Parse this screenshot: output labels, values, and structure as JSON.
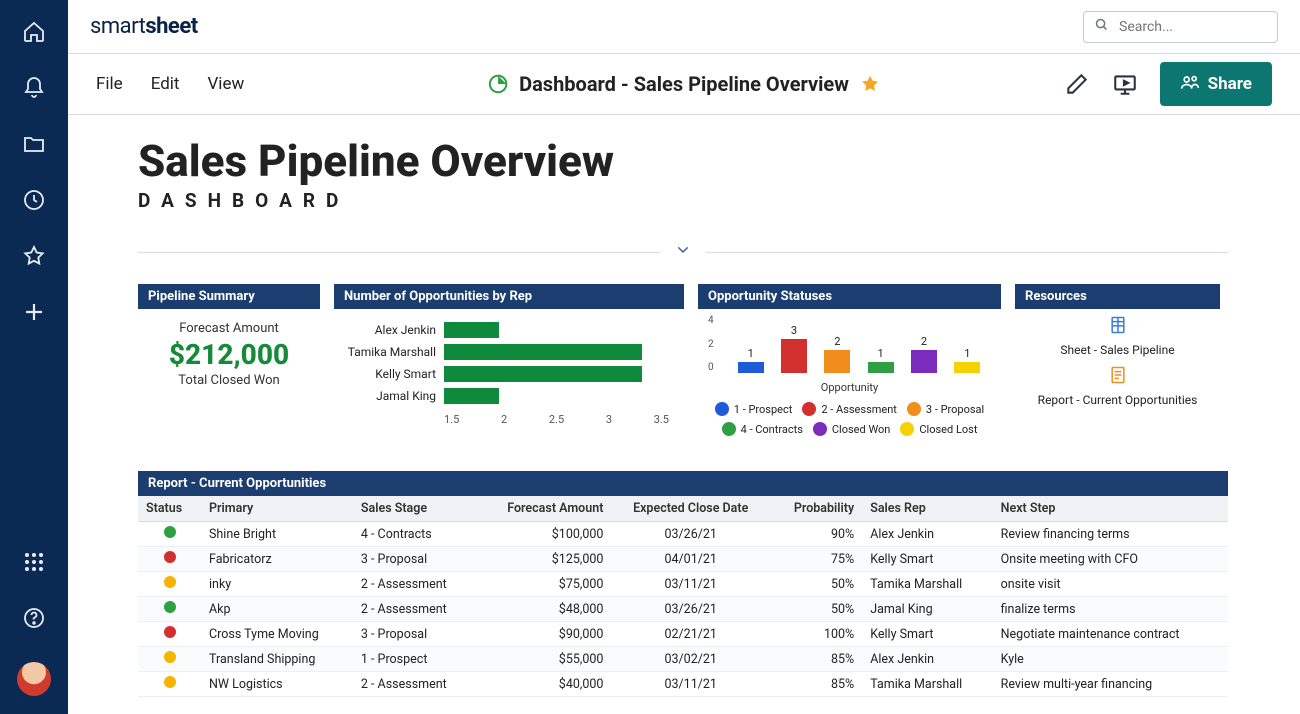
{
  "brand": {
    "part1": "smart",
    "part2": "sheet"
  },
  "search": {
    "placeholder": "Search..."
  },
  "menu": {
    "file": "File",
    "edit": "Edit",
    "view": "View"
  },
  "title": "Dashboard - Sales Pipeline Overview",
  "share_label": "Share",
  "dashboard": {
    "heading": "Sales Pipeline Overview",
    "subhead": "DASHBOARD"
  },
  "pipeline": {
    "head": "Pipeline Summary",
    "forecast_label": "Forecast Amount",
    "forecast_value": "$212,000",
    "closed_label": "Total Closed Won"
  },
  "reps": {
    "head": "Number of Opportunities by Rep"
  },
  "status": {
    "head": "Opportunity Statuses",
    "xlabel": "Opportunity"
  },
  "resources": {
    "head": "Resources",
    "sheet": "Sheet - Sales Pipeline",
    "report": "Report - Current Opportunities"
  },
  "report": {
    "head": "Report - Current Opportunities",
    "cols": {
      "status": "Status",
      "primary": "Primary",
      "stage": "Sales Stage",
      "forecast": "Forecast Amount",
      "close": "Expected Close Date",
      "prob": "Probability",
      "rep": "Sales Rep",
      "next": "Next Step"
    },
    "rows": [
      {
        "c": "#2ea043",
        "p": "Shine Bright",
        "s": "4 - Contracts",
        "f": "$100,000",
        "d": "03/26/21",
        "pr": "90%",
        "r": "Alex Jenkin",
        "n": "Review financing terms"
      },
      {
        "c": "#d22f2f",
        "p": "Fabricatorz",
        "s": "3 - Proposal",
        "f": "$125,000",
        "d": "04/01/21",
        "pr": "75%",
        "r": "Kelly Smart",
        "n": "Onsite meeting with CFO"
      },
      {
        "c": "#f5b400",
        "p": "inky",
        "s": "2 - Assessment",
        "f": "$75,000",
        "d": "03/11/21",
        "pr": "50%",
        "r": "Tamika Marshall",
        "n": "onsite visit"
      },
      {
        "c": "#2ea043",
        "p": "Akp",
        "s": "2 - Assessment",
        "f": "$48,000",
        "d": "03/26/21",
        "pr": "50%",
        "r": "Jamal King",
        "n": "finalize terms"
      },
      {
        "c": "#d22f2f",
        "p": "Cross Tyme Moving",
        "s": "3 - Proposal",
        "f": "$90,000",
        "d": "02/21/21",
        "pr": "100%",
        "r": "Kelly Smart",
        "n": "Negotiate maintenance contract"
      },
      {
        "c": "#f5b400",
        "p": "Transland Shipping",
        "s": "1 - Prospect",
        "f": "$55,000",
        "d": "03/02/21",
        "pr": "85%",
        "r": "Alex Jenkin",
        "n": "Kyle"
      },
      {
        "c": "#f5b400",
        "p": "NW Logistics",
        "s": "2 - Assessment",
        "f": "$40,000",
        "d": "03/11/21",
        "pr": "85%",
        "r": "Tamika Marshall",
        "n": "Review multi-year financing"
      }
    ]
  },
  "chart_data": [
    {
      "id": "reps",
      "type": "bar",
      "orientation": "horizontal",
      "categories": [
        "Alex Jenkin",
        "Tamika Marshall",
        "Kelly Smart",
        "Jamal King"
      ],
      "values": [
        2.0,
        3.3,
        3.3,
        2.0
      ],
      "xlim": [
        1.5,
        3.5
      ],
      "xticks": [
        1.5,
        2,
        2.5,
        3,
        3.5
      ],
      "color": "#0f8a3c"
    },
    {
      "id": "status",
      "type": "bar",
      "categories": [
        "1 - Prospect",
        "2 - Assessment",
        "3 - Proposal",
        "4 - Contracts",
        "Closed Won",
        "Closed Lost"
      ],
      "values": [
        1,
        3,
        2,
        1,
        2,
        1
      ],
      "colors": [
        "#1f5bd8",
        "#d22f2f",
        "#f28c1a",
        "#2ea043",
        "#7b2cbf",
        "#f5d300"
      ],
      "ylim": [
        0,
        4
      ],
      "yticks": [
        0,
        2,
        4
      ],
      "xlabel": "Opportunity"
    }
  ]
}
